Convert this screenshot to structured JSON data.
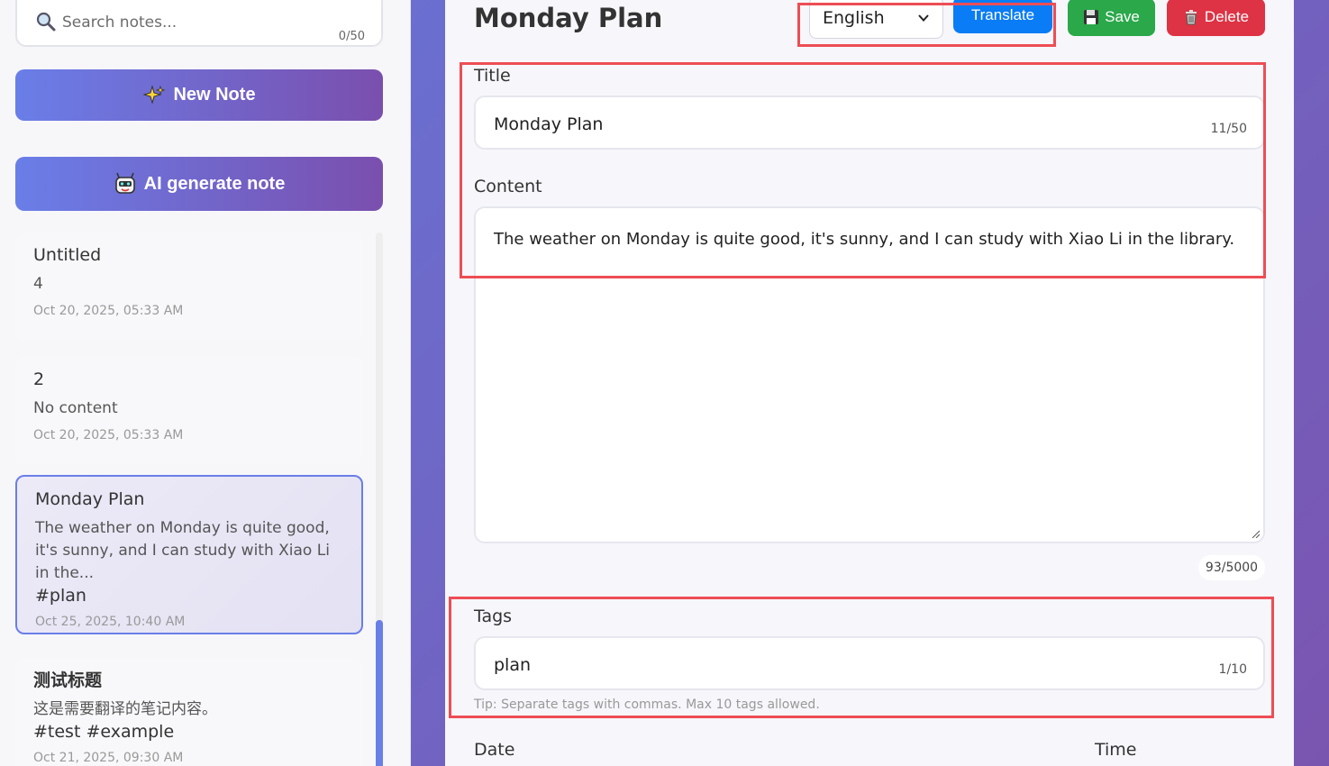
{
  "sidebar": {
    "search": {
      "placeholder": "Search notes...",
      "value": "",
      "count": "0/50"
    },
    "new_note_label": "New Note",
    "ai_generate_label": "AI generate note",
    "notes": [
      {
        "title": "Untitled",
        "preview": "4",
        "tags": "",
        "date": "Oct 20, 2025, 05:33 AM"
      },
      {
        "title": "2",
        "preview": "No content",
        "tags": "",
        "date": "Oct 20, 2025, 05:33 AM"
      },
      {
        "title": "Monday Plan",
        "preview": "The weather on Monday is quite good, it's sunny, and I can study with Xiao Li in the...",
        "tags": "#plan",
        "date": "Oct 25, 2025, 10:40 AM",
        "active": true
      },
      {
        "title": "测试标题",
        "preview": "这是需要翻译的笔记内容。",
        "tags": "#test #example",
        "date": "Oct 21, 2025, 09:30 AM"
      }
    ]
  },
  "editor": {
    "page_title": "Monday Plan",
    "language": {
      "selected": "English"
    },
    "translate_label": "Translate",
    "save_label": "Save",
    "delete_label": "Delete",
    "title_field": {
      "label": "Title",
      "value": "Monday Plan",
      "count": "11/50"
    },
    "content_field": {
      "label": "Content",
      "value": "The weather on Monday is quite good, it's sunny, and I can study with Xiao Li in the library.",
      "count": "93/5000"
    },
    "tags_field": {
      "label": "Tags",
      "value": "plan",
      "count": "1/10",
      "tip": "Tip: Separate tags with commas. Max 10 tags allowed."
    },
    "date_label": "Date",
    "time_label": "Time"
  },
  "colors": {
    "accent_gradient_start": "#6a7ee8",
    "accent_gradient_end": "#7a4fae",
    "translate": "#0a7cf5",
    "save": "#2aa84a",
    "delete": "#dd3344",
    "highlight": "#ee4d55"
  },
  "icons": {
    "search": "magnifier-icon",
    "new_note": "sparkles-icon",
    "ai": "robot-icon",
    "save": "floppy-disk-icon",
    "delete": "trash-icon"
  }
}
